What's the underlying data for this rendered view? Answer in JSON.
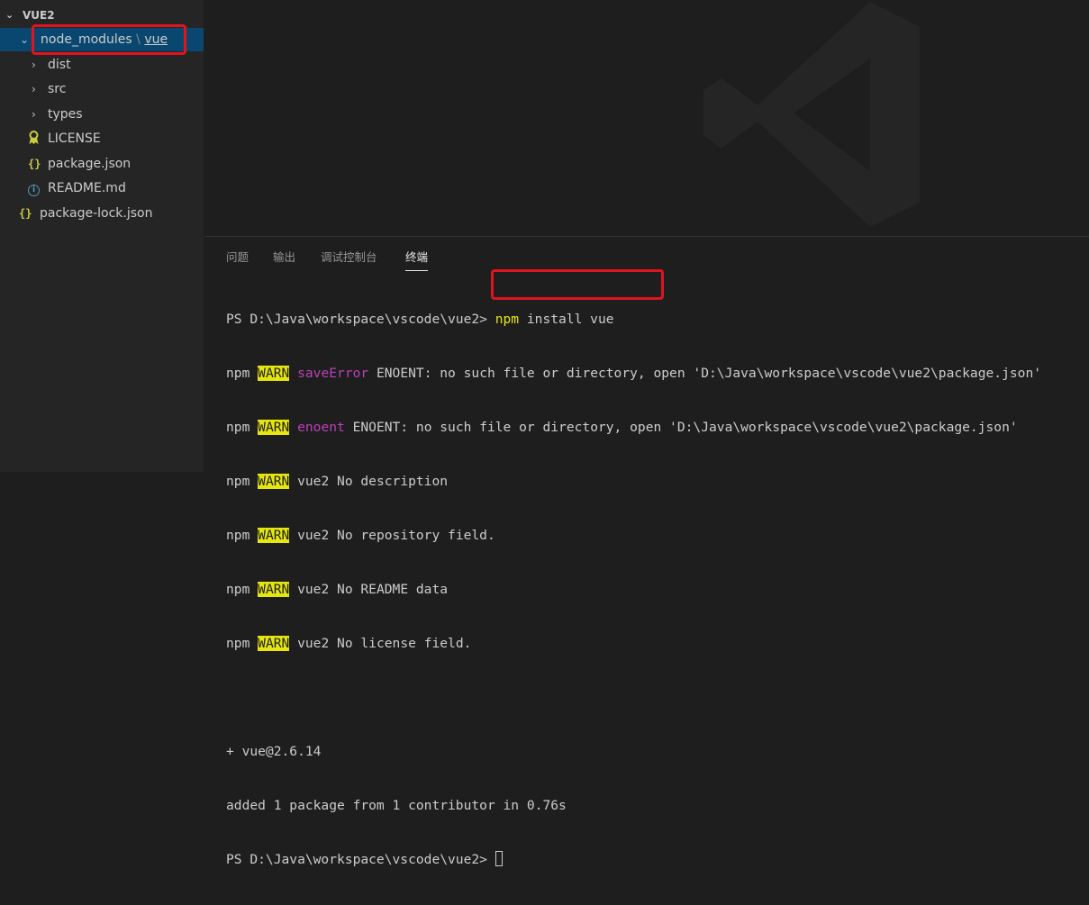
{
  "explorer": {
    "root_label": "VUE2",
    "items": [
      {
        "label_part1": "node_modules",
        "separator": "\\",
        "label_part2": "vue"
      },
      {
        "label": "dist"
      },
      {
        "label": "src"
      },
      {
        "label": "types"
      },
      {
        "label": "LICENSE"
      },
      {
        "label": "package.json"
      },
      {
        "label": "README.md"
      },
      {
        "label": "package-lock.json"
      }
    ],
    "icons": {
      "chevron_down": "chevron-down-icon",
      "chevron_right": "chevron-right-icon",
      "license": "license-icon",
      "json": "json-file-icon",
      "info": "info-icon"
    }
  },
  "panel": {
    "tabs": [
      {
        "label": "问题"
      },
      {
        "label": "输出"
      },
      {
        "label": "调试控制台"
      },
      {
        "label": "终端",
        "active": true
      }
    ]
  },
  "terminal": {
    "prompt": "PS D:\\Java\\workspace\\vscode\\vue2> ",
    "command": "npm install vue",
    "lines": [
      {
        "prefix": "npm ",
        "level": "WARN",
        "tag": "saveError",
        "text": " ENOENT: no such file or directory, open 'D:\\Java\\workspace\\vscode\\vue2\\package.json'"
      },
      {
        "prefix": "npm ",
        "level": "WARN",
        "tag": "enoent",
        "text": " ENOENT: no such file or directory, open 'D:\\Java\\workspace\\vscode\\vue2\\package.json'"
      },
      {
        "prefix": "npm ",
        "level": "WARN",
        "text": " vue2 No description"
      },
      {
        "prefix": "npm ",
        "level": "WARN",
        "text": " vue2 No repository field."
      },
      {
        "prefix": "npm ",
        "level": "WARN",
        "text": " vue2 No README data"
      },
      {
        "prefix": "npm ",
        "level": "WARN",
        "text": " vue2 No license field."
      }
    ],
    "installed": "+ vue@2.6.14",
    "summary": "added 1 package from 1 contributor in 0.76s",
    "final_prompt": "PS D:\\Java\\workspace\\vscode\\vue2> "
  },
  "colors": {
    "accent_selection": "#094771",
    "highlight_box": "#e0141e",
    "warn_bg": "#e5e510",
    "magenta": "#bc3fbc"
  }
}
